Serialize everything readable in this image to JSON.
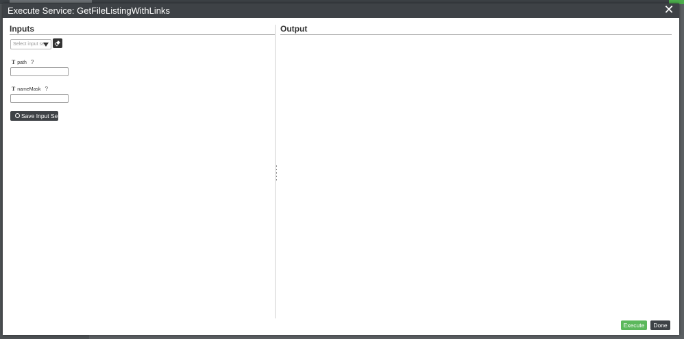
{
  "dialog": {
    "title": "Execute Service: GetFileListingWithLinks",
    "close_label": "✕"
  },
  "inputs_pane": {
    "title": "Inputs",
    "input_set_placeholder": "Select input set",
    "fields": [
      {
        "name": "path",
        "type_icon": "T",
        "help": "?",
        "value": ""
      },
      {
        "name": "nameMask",
        "type_icon": "T",
        "help": "?",
        "value": ""
      }
    ],
    "save_label": "Save Input Set"
  },
  "output_pane": {
    "title": "Output"
  },
  "footer": {
    "execute_label": "Execute",
    "done_label": "Done"
  },
  "colors": {
    "header_bg": "#3e4246",
    "execute_green": "#5cb85c",
    "dark_button": "#3e4246",
    "page_overlay": "#5b5f62"
  },
  "icons": {
    "close": "close-icon",
    "eraser": "eraser-icon",
    "dropdown": "chevron-down-icon",
    "save": "circle-icon",
    "help": "help-icon",
    "type": "text-type-icon"
  }
}
